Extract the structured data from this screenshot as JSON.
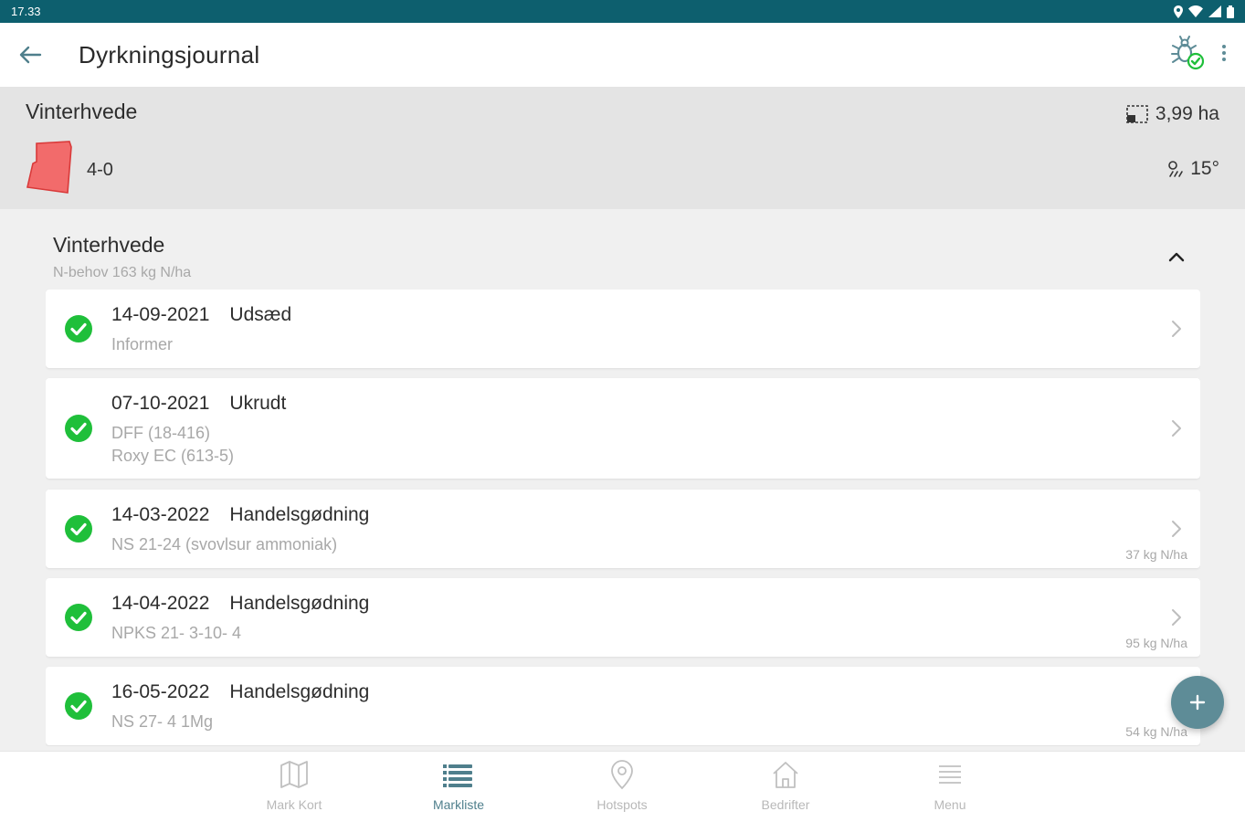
{
  "status_bar": {
    "time": "17.33"
  },
  "app_bar": {
    "title": "Dyrkningsjournal"
  },
  "field": {
    "crop": "Vinterhvede",
    "area": "3,99 ha",
    "id": "4-0",
    "temperature": "15°"
  },
  "section": {
    "title": "Vinterhvede",
    "subtitle": "N-behov 163 kg N/ha"
  },
  "tasks": [
    {
      "date": "14-09-2021",
      "type": "Udsæd",
      "lines": [
        "Informer"
      ],
      "amount": ""
    },
    {
      "date": "07-10-2021",
      "type": "Ukrudt",
      "lines": [
        "DFF (18-416)",
        "Roxy EC (613-5)"
      ],
      "amount": ""
    },
    {
      "date": "14-03-2022",
      "type": "Handelsgødning",
      "lines": [
        "NS 21-24 (svovlsur ammoniak)"
      ],
      "amount": "37 kg N/ha"
    },
    {
      "date": "14-04-2022",
      "type": "Handelsgødning",
      "lines": [
        "NPKS 21- 3-10- 4"
      ],
      "amount": "95 kg N/ha"
    },
    {
      "date": "16-05-2022",
      "type": "Handelsgødning",
      "lines": [
        "NS 27- 4 1Mg"
      ],
      "amount": "54 kg N/ha"
    }
  ],
  "bottom_nav": [
    {
      "label": "Mark Kort",
      "icon": "map-icon"
    },
    {
      "label": "Markliste",
      "icon": "list-icon"
    },
    {
      "label": "Hotspots",
      "icon": "pin-icon"
    },
    {
      "label": "Bedrifter",
      "icon": "home-icon"
    },
    {
      "label": "Menu",
      "icon": "menu-icon"
    }
  ],
  "colors": {
    "status_bar": "#0d5f6e",
    "check": "#1fbf3a",
    "fab": "#5e8c97",
    "active_nav": "#4f7f8c",
    "field_shape": "#f26b6b"
  }
}
